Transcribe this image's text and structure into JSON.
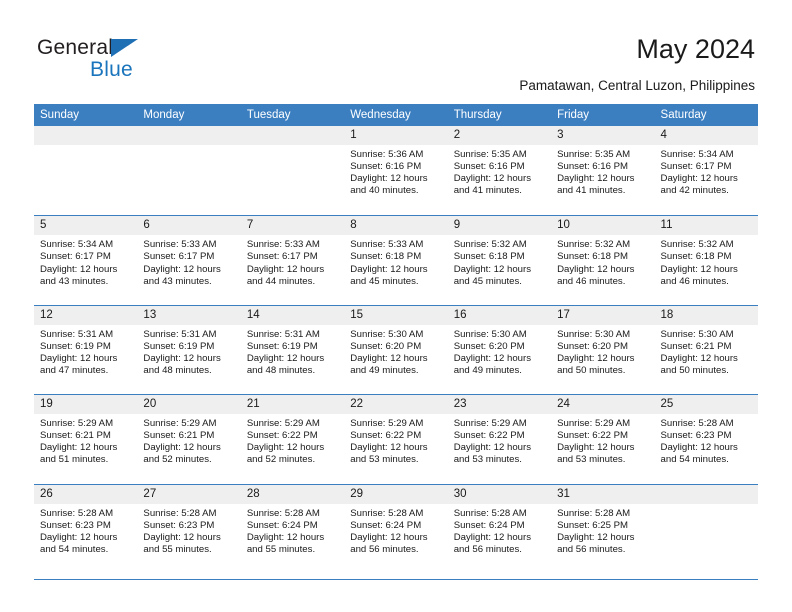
{
  "brand": {
    "name_part1": "General",
    "name_part2": "Blue",
    "triangle_icon": "triangle-icon",
    "colors": {
      "dark": "#231f20",
      "blue": "#1b75bc"
    }
  },
  "header": {
    "title": "May 2024",
    "subtitle": "Pamatawan, Central Luzon, Philippines"
  },
  "calendar": {
    "header_color": "#3c7fc1",
    "daynum_band_color": "#efefef",
    "weekdays": [
      "Sunday",
      "Monday",
      "Tuesday",
      "Wednesday",
      "Thursday",
      "Friday",
      "Saturday"
    ],
    "weeks": [
      [
        {
          "day": "",
          "lines": []
        },
        {
          "day": "",
          "lines": []
        },
        {
          "day": "",
          "lines": []
        },
        {
          "day": "1",
          "lines": [
            "Sunrise: 5:36 AM",
            "Sunset: 6:16 PM",
            "Daylight: 12 hours",
            "and 40 minutes."
          ]
        },
        {
          "day": "2",
          "lines": [
            "Sunrise: 5:35 AM",
            "Sunset: 6:16 PM",
            "Daylight: 12 hours",
            "and 41 minutes."
          ]
        },
        {
          "day": "3",
          "lines": [
            "Sunrise: 5:35 AM",
            "Sunset: 6:16 PM",
            "Daylight: 12 hours",
            "and 41 minutes."
          ]
        },
        {
          "day": "4",
          "lines": [
            "Sunrise: 5:34 AM",
            "Sunset: 6:17 PM",
            "Daylight: 12 hours",
            "and 42 minutes."
          ]
        }
      ],
      [
        {
          "day": "5",
          "lines": [
            "Sunrise: 5:34 AM",
            "Sunset: 6:17 PM",
            "Daylight: 12 hours",
            "and 43 minutes."
          ]
        },
        {
          "day": "6",
          "lines": [
            "Sunrise: 5:33 AM",
            "Sunset: 6:17 PM",
            "Daylight: 12 hours",
            "and 43 minutes."
          ]
        },
        {
          "day": "7",
          "lines": [
            "Sunrise: 5:33 AM",
            "Sunset: 6:17 PM",
            "Daylight: 12 hours",
            "and 44 minutes."
          ]
        },
        {
          "day": "8",
          "lines": [
            "Sunrise: 5:33 AM",
            "Sunset: 6:18 PM",
            "Daylight: 12 hours",
            "and 45 minutes."
          ]
        },
        {
          "day": "9",
          "lines": [
            "Sunrise: 5:32 AM",
            "Sunset: 6:18 PM",
            "Daylight: 12 hours",
            "and 45 minutes."
          ]
        },
        {
          "day": "10",
          "lines": [
            "Sunrise: 5:32 AM",
            "Sunset: 6:18 PM",
            "Daylight: 12 hours",
            "and 46 minutes."
          ]
        },
        {
          "day": "11",
          "lines": [
            "Sunrise: 5:32 AM",
            "Sunset: 6:18 PM",
            "Daylight: 12 hours",
            "and 46 minutes."
          ]
        }
      ],
      [
        {
          "day": "12",
          "lines": [
            "Sunrise: 5:31 AM",
            "Sunset: 6:19 PM",
            "Daylight: 12 hours",
            "and 47 minutes."
          ]
        },
        {
          "day": "13",
          "lines": [
            "Sunrise: 5:31 AM",
            "Sunset: 6:19 PM",
            "Daylight: 12 hours",
            "and 48 minutes."
          ]
        },
        {
          "day": "14",
          "lines": [
            "Sunrise: 5:31 AM",
            "Sunset: 6:19 PM",
            "Daylight: 12 hours",
            "and 48 minutes."
          ]
        },
        {
          "day": "15",
          "lines": [
            "Sunrise: 5:30 AM",
            "Sunset: 6:20 PM",
            "Daylight: 12 hours",
            "and 49 minutes."
          ]
        },
        {
          "day": "16",
          "lines": [
            "Sunrise: 5:30 AM",
            "Sunset: 6:20 PM",
            "Daylight: 12 hours",
            "and 49 minutes."
          ]
        },
        {
          "day": "17",
          "lines": [
            "Sunrise: 5:30 AM",
            "Sunset: 6:20 PM",
            "Daylight: 12 hours",
            "and 50 minutes."
          ]
        },
        {
          "day": "18",
          "lines": [
            "Sunrise: 5:30 AM",
            "Sunset: 6:21 PM",
            "Daylight: 12 hours",
            "and 50 minutes."
          ]
        }
      ],
      [
        {
          "day": "19",
          "lines": [
            "Sunrise: 5:29 AM",
            "Sunset: 6:21 PM",
            "Daylight: 12 hours",
            "and 51 minutes."
          ]
        },
        {
          "day": "20",
          "lines": [
            "Sunrise: 5:29 AM",
            "Sunset: 6:21 PM",
            "Daylight: 12 hours",
            "and 52 minutes."
          ]
        },
        {
          "day": "21",
          "lines": [
            "Sunrise: 5:29 AM",
            "Sunset: 6:22 PM",
            "Daylight: 12 hours",
            "and 52 minutes."
          ]
        },
        {
          "day": "22",
          "lines": [
            "Sunrise: 5:29 AM",
            "Sunset: 6:22 PM",
            "Daylight: 12 hours",
            "and 53 minutes."
          ]
        },
        {
          "day": "23",
          "lines": [
            "Sunrise: 5:29 AM",
            "Sunset: 6:22 PM",
            "Daylight: 12 hours",
            "and 53 minutes."
          ]
        },
        {
          "day": "24",
          "lines": [
            "Sunrise: 5:29 AM",
            "Sunset: 6:22 PM",
            "Daylight: 12 hours",
            "and 53 minutes."
          ]
        },
        {
          "day": "25",
          "lines": [
            "Sunrise: 5:28 AM",
            "Sunset: 6:23 PM",
            "Daylight: 12 hours",
            "and 54 minutes."
          ]
        }
      ],
      [
        {
          "day": "26",
          "lines": [
            "Sunrise: 5:28 AM",
            "Sunset: 6:23 PM",
            "Daylight: 12 hours",
            "and 54 minutes."
          ]
        },
        {
          "day": "27",
          "lines": [
            "Sunrise: 5:28 AM",
            "Sunset: 6:23 PM",
            "Daylight: 12 hours",
            "and 55 minutes."
          ]
        },
        {
          "day": "28",
          "lines": [
            "Sunrise: 5:28 AM",
            "Sunset: 6:24 PM",
            "Daylight: 12 hours",
            "and 55 minutes."
          ]
        },
        {
          "day": "29",
          "lines": [
            "Sunrise: 5:28 AM",
            "Sunset: 6:24 PM",
            "Daylight: 12 hours",
            "and 56 minutes."
          ]
        },
        {
          "day": "30",
          "lines": [
            "Sunrise: 5:28 AM",
            "Sunset: 6:24 PM",
            "Daylight: 12 hours",
            "and 56 minutes."
          ]
        },
        {
          "day": "31",
          "lines": [
            "Sunrise: 5:28 AM",
            "Sunset: 6:25 PM",
            "Daylight: 12 hours",
            "and 56 minutes."
          ]
        },
        {
          "day": "",
          "lines": []
        }
      ]
    ]
  }
}
